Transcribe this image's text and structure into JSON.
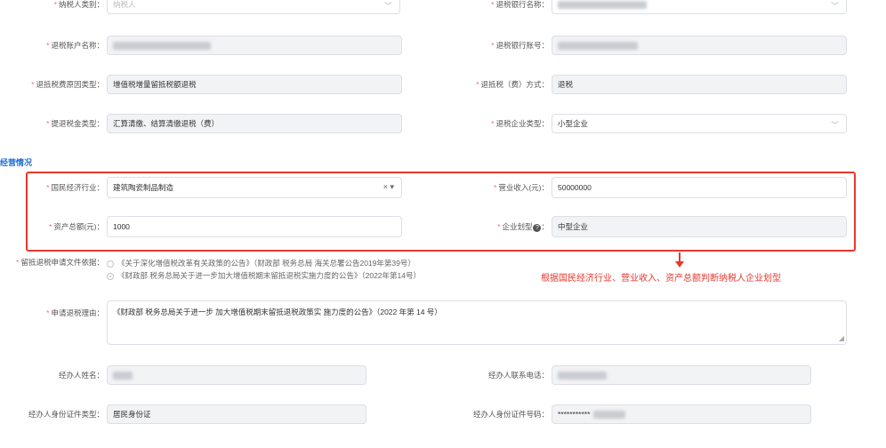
{
  "rows": {
    "taxpayer_type": {
      "label": "纳税人类别：",
      "placeholder": "纳税人"
    },
    "refund_bank_name": {
      "label": "退税银行名称："
    },
    "refund_account_name": {
      "label": "退税账户名称："
    },
    "refund_bank_account": {
      "label": "退税银行账号："
    },
    "refund_reason_type": {
      "label": "退抵税费原因类型：",
      "value": "增值税增量留抵税额退税"
    },
    "refund_method": {
      "label": "退抵税（费）方式：",
      "value": "退税"
    },
    "refund_amount_type": {
      "label": "提退税金类型：",
      "value": "汇算清缴、结算清缴退税（费）"
    },
    "refund_enterprise_type": {
      "label": "退税企业类型：",
      "value": "小型企业"
    }
  },
  "section": {
    "title": "经营情况"
  },
  "business": {
    "industry": {
      "label": "国民经济行业：",
      "value": "建筑陶瓷制品制造",
      "clear": "×"
    },
    "revenue": {
      "label": "营业收入(元)：",
      "value": "50000000"
    },
    "total_assets": {
      "label": "资产总额(元)：",
      "value": "1000"
    },
    "enterprise_scale": {
      "label": "企业划型",
      "help": "?",
      "colon": "：",
      "value": "中型企业"
    }
  },
  "annotation": {
    "text": "根据国民经济行业、营业收入、资产总额判断纳税人企业划型"
  },
  "basis": {
    "label": "留抵退税申请文件依据：",
    "options": [
      "《关于深化增值税改革有关政策的公告》（财政部 税务总局 海关总署公告2019年第39号）",
      "《财政部 税务总局关于进一步加大增值税期末留抵退税实施力度的公告》（2022年第14号）"
    ]
  },
  "reason": {
    "label": "申请退税理由：",
    "value": "《财政部 税务总局关于进一步 加大增值税期末留抵退税政策实 施力度的公告》（2022 年第 14 号）"
  },
  "agent": {
    "name_label": "经办人姓名：",
    "phone_label": "经办人联系电话：",
    "id_type_label": "经办人身份证件类型：",
    "id_type_value": "居民身份证",
    "id_no_label": "经办人身份证件号码：",
    "id_no_value": "***********"
  },
  "colors": {
    "required": "#f56c6c",
    "highlight": "#e8382e",
    "section": "#1f6fd1"
  }
}
